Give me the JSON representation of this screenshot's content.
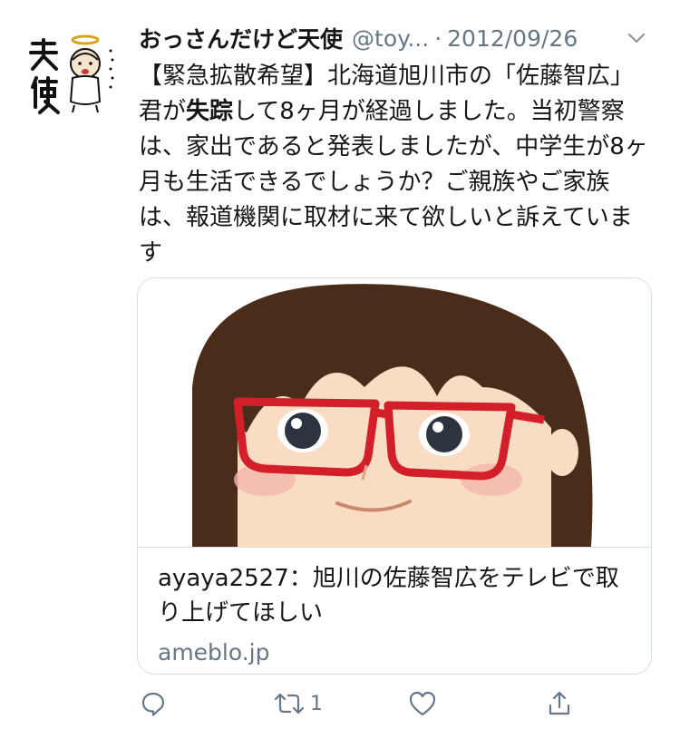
{
  "tweet": {
    "author_name": "おっさんだけど天使",
    "handle": "@toy...",
    "separator": "·",
    "date": "2012/09/26",
    "text_before_bold": "【緊急拡散希望】北海道旭川市の「佐藤智広」君が",
    "text_bold": "失踪",
    "text_after_bold": "して8ヶ月が経過しました。当初警察は、家出であると発表しましたが、中学生が8ヶ月も生活できるでしょうか？ご親族やご家族は、報道機関に取材に来て欲しいと訴えています"
  },
  "card": {
    "title": "ayaya2527：旭川の佐藤智広をテレビで取り上げてほしい",
    "domain": "ameblo.jp"
  },
  "actions": {
    "reply_count": "",
    "retweet_count": "1",
    "like_count": "",
    "icons": [
      "reply-icon",
      "retweet-icon",
      "like-icon",
      "share-icon"
    ]
  },
  "colors": {
    "text": "#14171a",
    "secondary": "#657786",
    "border": "#d6dde3",
    "glasses": "#d21f2a",
    "hair": "#4a2c1a"
  }
}
